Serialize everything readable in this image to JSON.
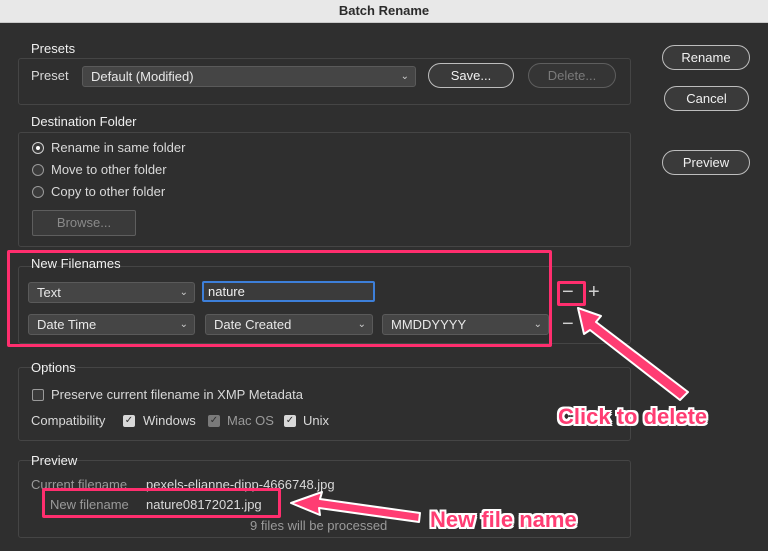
{
  "window": {
    "title": "Batch Rename"
  },
  "side_buttons": {
    "rename": "Rename",
    "cancel": "Cancel",
    "preview": "Preview"
  },
  "presets": {
    "title": "Presets",
    "preset_label": "Preset",
    "preset_value": "Default (Modified)",
    "save_label": "Save...",
    "delete_label": "Delete..."
  },
  "destination": {
    "title": "Destination Folder",
    "options": [
      "Rename in same folder",
      "Move to other folder",
      "Copy to other folder"
    ],
    "selected_index": 0,
    "browse_label": "Browse..."
  },
  "new_filenames": {
    "title": "New Filenames",
    "row1": {
      "type": "Text",
      "value": "nature"
    },
    "row2": {
      "type": "Date Time",
      "field": "Date Created",
      "format": "MMDDYYYY"
    },
    "minus": "−",
    "plus": "+"
  },
  "options": {
    "title": "Options",
    "preserve_label": "Preserve current filename in XMP Metadata",
    "preserve_checked": false,
    "compat_label": "Compatibility",
    "windows": "Windows",
    "macos": "Mac OS",
    "unix": "Unix"
  },
  "preview": {
    "title": "Preview",
    "current_label": "Current filename",
    "current_value": "pexels-elianne-dipp-4666748.jpg",
    "new_label": "New filename",
    "new_value": "nature08172021.jpg",
    "count_text": "9 files will be processed"
  },
  "annotations": {
    "click_to_delete": "Click to delete",
    "new_file_name": "New file name",
    "accent_color": "#ff2e6e"
  }
}
